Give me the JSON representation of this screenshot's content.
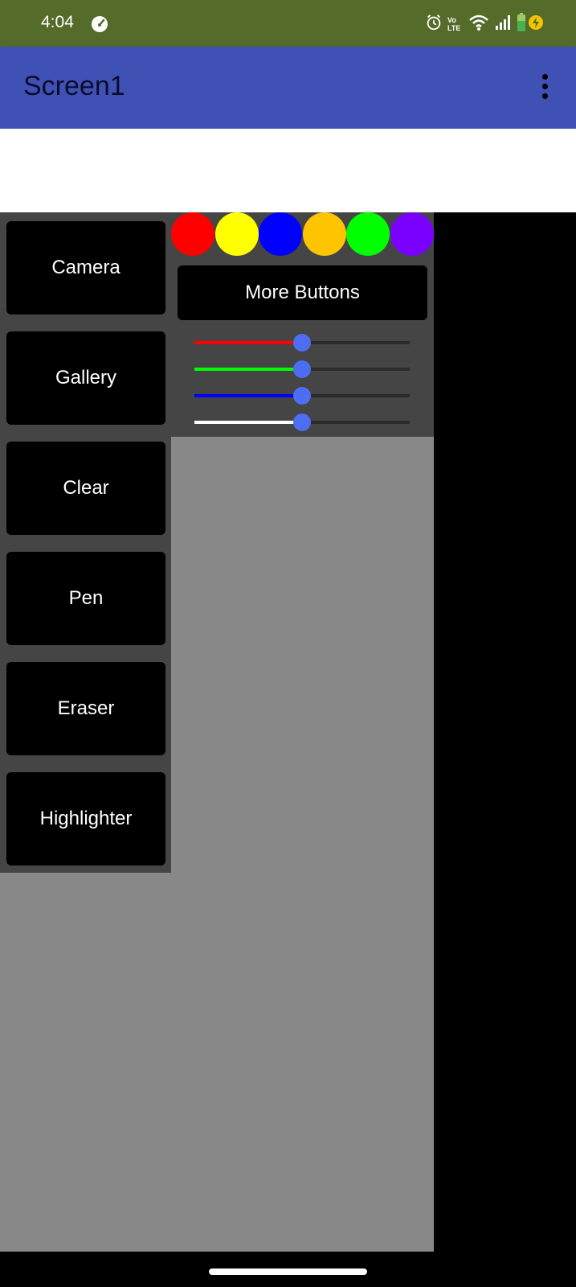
{
  "status_bar": {
    "time": "4:04",
    "volte_label": "Vo LTE",
    "icons": [
      "speedometer-icon",
      "alarm-icon",
      "volte-icon",
      "wifi-icon",
      "signal-icon",
      "battery-charging-icon"
    ],
    "background": "#556b2a"
  },
  "app_bar": {
    "title": "Screen1",
    "menu_icon": "more-vert-icon",
    "background": "#3f51b5"
  },
  "tools": {
    "buttons": [
      {
        "label": "Camera"
      },
      {
        "label": "Gallery"
      },
      {
        "label": "Clear"
      },
      {
        "label": "Pen"
      },
      {
        "label": "Eraser"
      },
      {
        "label": "Highlighter"
      }
    ]
  },
  "palette": {
    "colors": [
      "#ff0000",
      "#ffff00",
      "#0000ff",
      "#ffc400",
      "#00ff00",
      "#7a00ff"
    ]
  },
  "more_button": {
    "label": "More Buttons"
  },
  "sliders": [
    {
      "name": "red",
      "color": "#ff0000",
      "value": 0.5
    },
    {
      "name": "green",
      "color": "#00ff00",
      "value": 0.5
    },
    {
      "name": "blue",
      "color": "#0000ff",
      "value": 0.5
    },
    {
      "name": "white",
      "color": "#ffffff",
      "value": 0.5
    }
  ],
  "canvas": {
    "background": "#888888"
  }
}
